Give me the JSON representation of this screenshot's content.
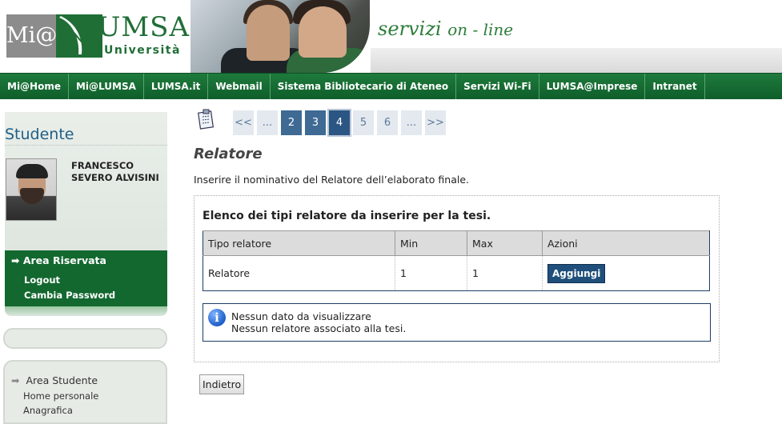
{
  "header": {
    "logo_mi": "Mi@",
    "logo_lumsa": "LUMSA",
    "logo_universita": "Università",
    "servizi_word": "servizi",
    "servizi_online": "on - line"
  },
  "nav": {
    "items": [
      "Mi@Home",
      "Mi@LUMSA",
      "LUMSA.it",
      "Webmail",
      "Sistema Bibliotecario di Ateneo",
      "Servizi Wi-Fi",
      "LUMSA@Imprese",
      "Intranet"
    ]
  },
  "sidebar": {
    "title": "Studente",
    "student_name": "FRANCESCO SEVERO ALVISINI",
    "reserved_area": "Area Riservata",
    "reserved_links": [
      "Logout",
      "Cambia Password"
    ],
    "student_area": "Area Studente",
    "student_links": [
      "Home personale",
      "Anagrafica"
    ]
  },
  "pager": {
    "items": [
      "<<",
      "...",
      "2",
      "3",
      "4",
      "5",
      "6",
      "...",
      ">>"
    ],
    "current": "4"
  },
  "main": {
    "title": "Relatore",
    "intro": "Inserire il nominativo del Relatore dell’elaborato finale.",
    "panel_title": "Elenco dei tipi relatore da inserire per la tesi.",
    "table": {
      "headers": [
        "Tipo relatore",
        "Min",
        "Max",
        "Azioni"
      ],
      "rows": [
        {
          "tipo": "Relatore",
          "min": "1",
          "max": "1",
          "action": "Aggiungi"
        }
      ]
    },
    "info_lines": [
      "Nessun dato da visualizzare",
      "Nessun relatore associato alla tesi."
    ],
    "back_button": "Indietro"
  },
  "colors": {
    "brand_green": "#13682f",
    "nav_green": "#1e7a3c",
    "accent_blue": "#1f4f7a",
    "title_blue": "#1f5f86"
  }
}
